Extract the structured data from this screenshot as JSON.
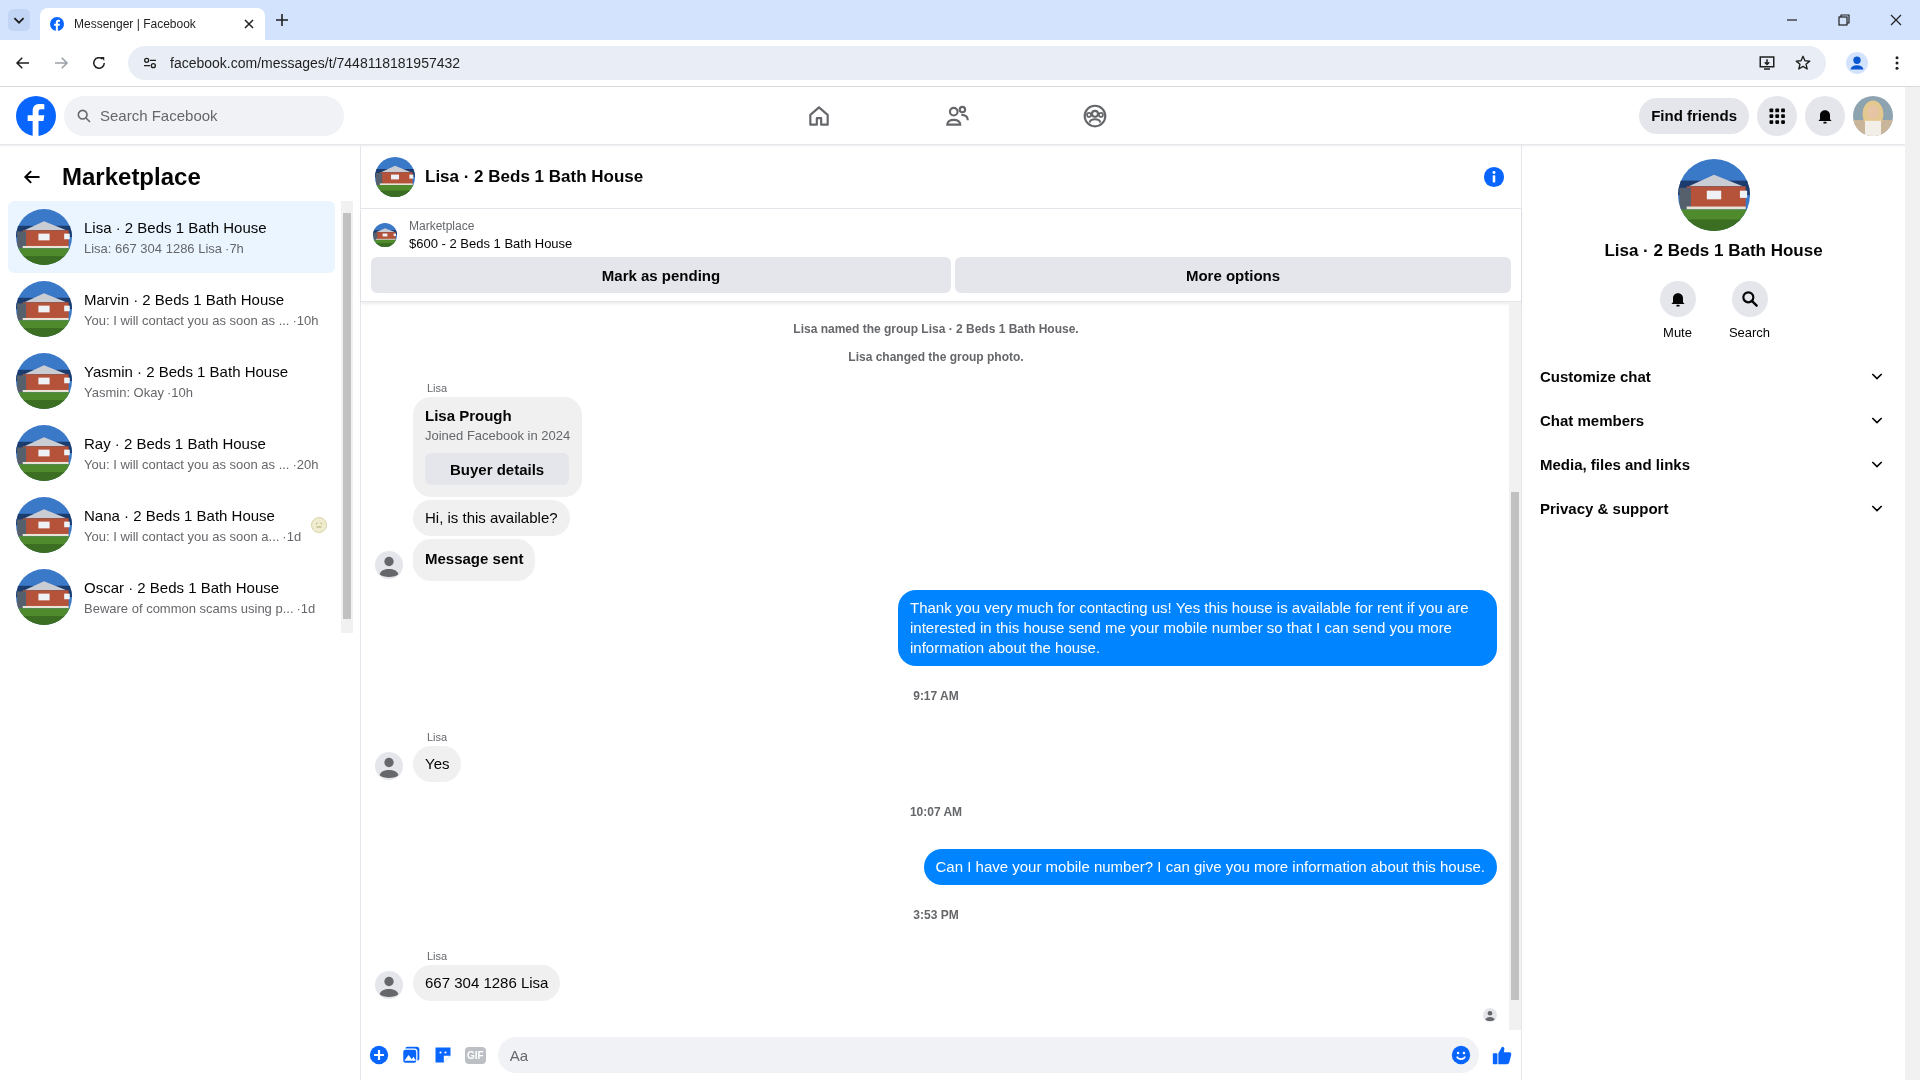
{
  "browser": {
    "tab_title": "Messenger | Facebook",
    "url": "facebook.com/messages/t/7448118181957432"
  },
  "topbar": {
    "search": {
      "placeholder": "Search Facebook"
    },
    "find_friends": "Find friends"
  },
  "sidebar": {
    "title": "Marketplace",
    "conversations": [
      {
        "name": "Lisa · 2 Beds 1 Bath House",
        "preview": "Lisa: 667 304 1286 Lisa",
        "time": "·7h",
        "selected": true,
        "seen_icon": false
      },
      {
        "name": "Marvin · 2 Beds 1 Bath House",
        "preview": "You: I will contact you as soon as ...",
        "time": "·10h",
        "selected": false,
        "seen_icon": false
      },
      {
        "name": "Yasmin · 2 Beds 1 Bath House",
        "preview": "Yasmin: Okay",
        "time": "·10h",
        "selected": false,
        "seen_icon": false
      },
      {
        "name": "Ray · 2 Beds 1 Bath House",
        "preview": "You: I will contact you as soon as ...",
        "time": "·20h",
        "selected": false,
        "seen_icon": false
      },
      {
        "name": "Nana · 2 Beds 1 Bath House",
        "preview": "You: I will contact you as soon a...",
        "time": "·1d",
        "selected": false,
        "seen_icon": true
      },
      {
        "name": "Oscar · 2 Beds 1 Bath House",
        "preview": "Beware of common scams using p...",
        "time": "·1d",
        "selected": false,
        "seen_icon": false
      }
    ]
  },
  "chat": {
    "title": "Lisa · 2 Beds 1 Bath House",
    "listing": {
      "label": "Marketplace",
      "title": "$600 - 2 Beds 1 Bath House"
    },
    "actions": [
      "Mark as pending",
      "More options"
    ],
    "messages": [
      {
        "kind": "event",
        "text": "Lisa named the group Lisa · 2 Beds 1 Bath House."
      },
      {
        "kind": "event",
        "text": "Lisa changed the group photo."
      },
      {
        "kind": "sender",
        "text": "Lisa"
      },
      {
        "kind": "card",
        "name": "Lisa Prough",
        "detail": "Joined Facebook in 2024",
        "button": "Buyer details"
      },
      {
        "kind": "incoming",
        "text": "Hi, is this available?",
        "avatar": false,
        "bold": false
      },
      {
        "kind": "incoming",
        "text": "Message sent",
        "avatar": true,
        "bold": true
      },
      {
        "kind": "outgoing",
        "text": "Thank you very much for contacting us! Yes this house is available for rent if you are interested in this house send me your mobile number so that I can send you more information about the house."
      },
      {
        "kind": "time",
        "text": "9:17 AM"
      },
      {
        "kind": "sender",
        "text": "Lisa"
      },
      {
        "kind": "incoming",
        "text": "Yes",
        "avatar": true,
        "bold": false
      },
      {
        "kind": "time",
        "text": "10:07 AM"
      },
      {
        "kind": "outgoing",
        "text": "Can I have your mobile number? I can give you more information about this house."
      },
      {
        "kind": "time",
        "text": "3:53 PM"
      },
      {
        "kind": "sender",
        "text": "Lisa"
      },
      {
        "kind": "incoming",
        "text": "667 304 1286 Lisa",
        "avatar": true,
        "bold": false
      }
    ],
    "seen_avatar": true,
    "composer": {
      "placeholder": "Aa",
      "gif_label": "GIF"
    }
  },
  "details": {
    "title": "Lisa · 2 Beds 1 Bath House",
    "actions": [
      {
        "kind": "mute",
        "label": "Mute"
      },
      {
        "kind": "search",
        "label": "Search"
      }
    ],
    "sections": [
      {
        "label": "Customize chat",
        "expanded": false
      },
      {
        "label": "Chat members",
        "expanded": false
      },
      {
        "label": "Media, files and links",
        "expanded": false
      },
      {
        "label": "Privacy & support",
        "expanded": false
      }
    ]
  }
}
